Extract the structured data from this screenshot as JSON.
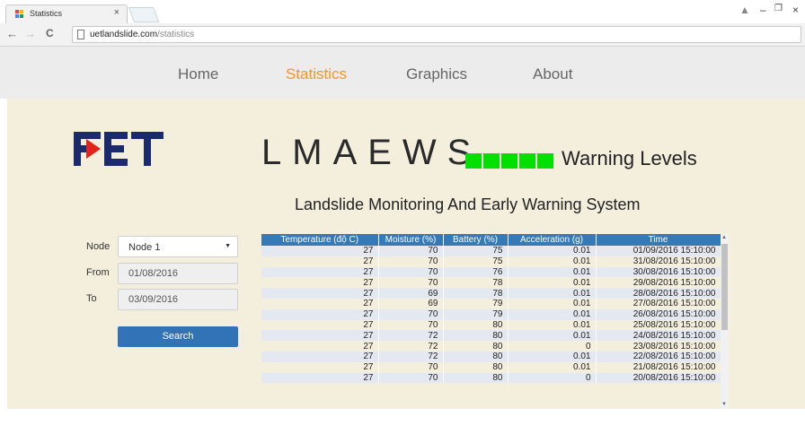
{
  "browser": {
    "tab_title": "Statistics",
    "tab_close": "×",
    "url_host": "uetlandslide.com",
    "url_path": "/statistics",
    "back": "←",
    "forward": "→",
    "reload": "C",
    "window_controls": [
      "▲",
      "–",
      "❐",
      "×"
    ]
  },
  "nav": {
    "items": [
      {
        "label": "Home",
        "active": false
      },
      {
        "label": "Statistics",
        "active": true
      },
      {
        "label": "Graphics",
        "active": false
      },
      {
        "label": "About",
        "active": false
      }
    ]
  },
  "header": {
    "logo_text": "FET",
    "title": "LMAEWS",
    "warning_label": "Warning Levels",
    "warning_level_color": "#00e000",
    "warning_level_count": 5,
    "subtitle": "Landslide Monitoring And Early Warning System"
  },
  "form": {
    "node_label": "Node",
    "node_value": "Node 1",
    "from_label": "From",
    "from_value": "01/08/2016",
    "to_label": "To",
    "to_value": "03/09/2016",
    "search_label": "Search"
  },
  "table": {
    "columns": [
      "Temperature (độ C)",
      "Moisture (%)",
      "Battery (%)",
      "Acceleration (g)",
      "Time"
    ],
    "rows": [
      [
        "27",
        "70",
        "75",
        "0.01",
        "01/09/2016 15:10:00"
      ],
      [
        "27",
        "70",
        "75",
        "0.01",
        "31/08/2016 15:10:00"
      ],
      [
        "27",
        "70",
        "76",
        "0.01",
        "30/08/2016 15:10:00"
      ],
      [
        "27",
        "70",
        "78",
        "0.01",
        "29/08/2016 15:10:00"
      ],
      [
        "27",
        "69",
        "78",
        "0.01",
        "28/08/2016 15:10:00"
      ],
      [
        "27",
        "69",
        "79",
        "0.01",
        "27/08/2016 15:10:00"
      ],
      [
        "27",
        "70",
        "79",
        "0.01",
        "26/08/2016 15:10:00"
      ],
      [
        "27",
        "70",
        "80",
        "0.01",
        "25/08/2016 15:10:00"
      ],
      [
        "27",
        "72",
        "80",
        "0.01",
        "24/08/2016 15:10:00"
      ],
      [
        "27",
        "72",
        "80",
        "0",
        "23/08/2016 15:10:00"
      ],
      [
        "27",
        "72",
        "80",
        "0.01",
        "22/08/2016 15:10:00"
      ],
      [
        "27",
        "70",
        "80",
        "0.01",
        "21/08/2016 15:10:00"
      ],
      [
        "27",
        "70",
        "80",
        "0",
        "20/08/2016 15:10:00"
      ]
    ]
  }
}
